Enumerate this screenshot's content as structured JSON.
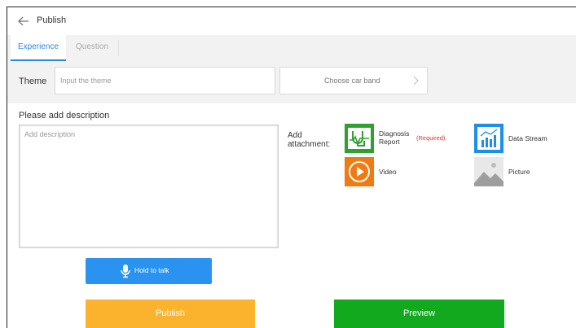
{
  "header": {
    "title": "Publish"
  },
  "tabs": [
    {
      "label": "Experience",
      "active": true
    },
    {
      "label": "Question",
      "active": false
    }
  ],
  "theme": {
    "label": "Theme",
    "placeholder": "Input the theme",
    "car_band_label": "Choose car band"
  },
  "description": {
    "title": "Please add description",
    "placeholder": "Add description"
  },
  "attachments": {
    "label": "Add attachment:",
    "items": [
      {
        "line1": "Diagnosis",
        "line2": "Report",
        "required": "(Required)",
        "icon": "diagnosis-icon",
        "color": "#2fa12f"
      },
      {
        "line1": "Data Stream",
        "icon": "data-stream-icon",
        "color": "#1e8fe6"
      },
      {
        "line1": "Video",
        "icon": "video-icon",
        "color": "#f07b13"
      },
      {
        "line1": "Picture",
        "icon": "picture-icon",
        "color": "#9e9e9e"
      }
    ]
  },
  "talk": {
    "label": "Hold to talk"
  },
  "buttons": {
    "publish": "Publish",
    "preview": "Preview"
  },
  "colors": {
    "accent": "#2a8ae3",
    "publish": "#fbb32d",
    "preview": "#12a91e",
    "required": "#e0322f"
  }
}
